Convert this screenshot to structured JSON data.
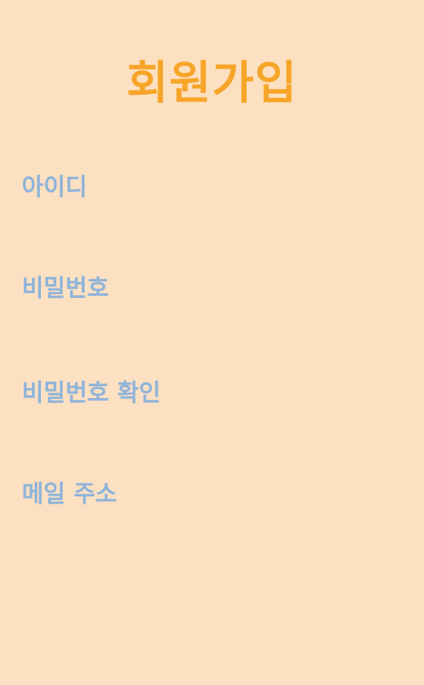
{
  "page": {
    "title": "회원가입"
  },
  "form": {
    "fields": [
      {
        "label": "아이디"
      },
      {
        "label": "비밀번호"
      },
      {
        "label": "비밀번호 확인"
      },
      {
        "label": "메일 주소"
      }
    ]
  },
  "colors": {
    "background": "#fce0c2",
    "title": "#f7a528",
    "label": "#8fb4d9"
  }
}
